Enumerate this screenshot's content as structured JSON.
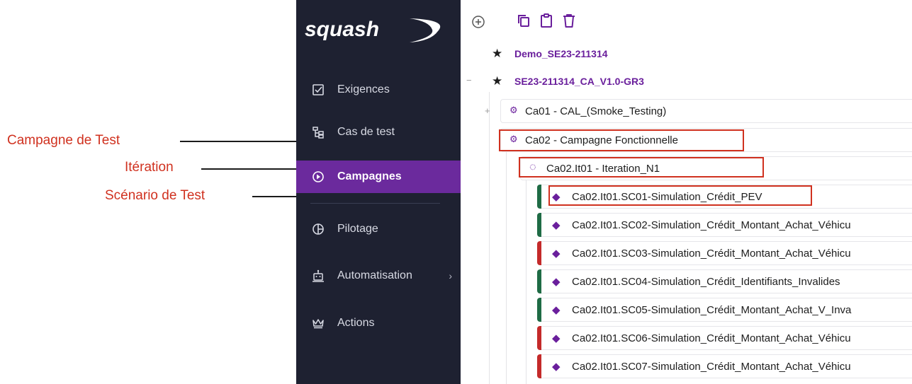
{
  "annotations": {
    "campagne": "Campagne de Test",
    "iteration": "Itération",
    "scenario": "Scénario de Test"
  },
  "sidebar": {
    "logo_text": "squash",
    "items": [
      {
        "label": "Exigences",
        "icon": "checkbox-icon"
      },
      {
        "label": "Cas de test",
        "icon": "tree-icon"
      },
      {
        "label": "Campagnes",
        "icon": "play-circle-icon",
        "active": true
      },
      {
        "label": "Pilotage",
        "icon": "pie-chart-icon"
      },
      {
        "label": "Automatisation",
        "icon": "robot-icon",
        "has_submenu": true
      },
      {
        "label": "Actions",
        "icon": "crown-icon"
      }
    ]
  },
  "toolbar": [
    "add-icon",
    "copy-icon",
    "paste-icon",
    "delete-icon"
  ],
  "tree": {
    "projects": [
      "Demo_SE23-211314",
      "SE23-211314_CA_V1.0-GR3"
    ],
    "campaigns": [
      "Ca01 - CAL_(Smoke_Testing)",
      "Ca02 - Campagne Fonctionnelle"
    ],
    "iteration": "Ca02.It01 - Iteration_N1",
    "suites": [
      {
        "label": "Ca02.It01.SC01-Simulation_Crédit_PEV",
        "status": "green"
      },
      {
        "label": "Ca02.It01.SC02-Simulation_Crédit_Montant_Achat_Véhicu",
        "status": "green"
      },
      {
        "label": "Ca02.It01.SC03-Simulation_Crédit_Montant_Achat_Véhicu",
        "status": "red"
      },
      {
        "label": "Ca02.It01.SC04-Simulation_Crédit_Identifiants_Invalides",
        "status": "green"
      },
      {
        "label": "Ca02.It01.SC05-Simulation_Crédit_Montant_Achat_V_Inva",
        "status": "green"
      },
      {
        "label": "Ca02.It01.SC06-Simulation_Crédit_Montant_Achat_Véhicu",
        "status": "red"
      },
      {
        "label": "Ca02.It01.SC07-Simulation_Crédit_Montant_Achat_Véhicu",
        "status": "red"
      }
    ]
  },
  "colors": {
    "green": "#1f6b45",
    "red": "#c42a2a",
    "accent": "#6b2a9d",
    "sidebar": "#1e2131"
  }
}
